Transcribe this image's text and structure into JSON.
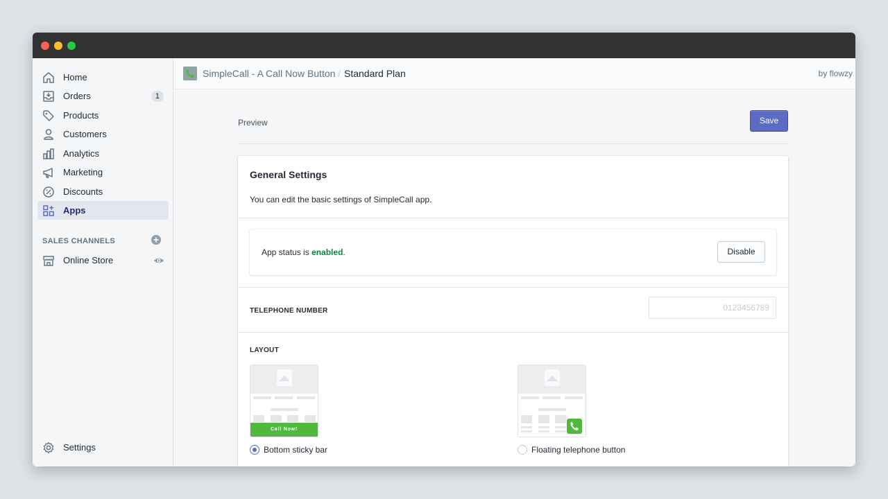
{
  "sidebar": {
    "items": [
      {
        "label": "Home",
        "icon": "home-icon"
      },
      {
        "label": "Orders",
        "icon": "orders-icon",
        "badge": "1"
      },
      {
        "label": "Products",
        "icon": "tag-icon"
      },
      {
        "label": "Customers",
        "icon": "person-icon"
      },
      {
        "label": "Analytics",
        "icon": "bar-chart-icon"
      },
      {
        "label": "Marketing",
        "icon": "megaphone-icon"
      },
      {
        "label": "Discounts",
        "icon": "discount-icon"
      },
      {
        "label": "Apps",
        "icon": "apps-icon",
        "active": true
      }
    ],
    "sales_channels_title": "SALES CHANNELS",
    "online_store_label": "Online Store",
    "settings_label": "Settings"
  },
  "topbar": {
    "app_name": "SimpleCall - A Call Now Button",
    "separator": "/",
    "page": "Standard Plan",
    "by": "by flowzy"
  },
  "main": {
    "preview_label": "Preview",
    "save_label": "Save",
    "card_title": "General Settings",
    "card_description": "You can edit the basic settings of SimpleCall app.",
    "status_prefix": "App status is ",
    "status_value": "enabled",
    "status_suffix": ".",
    "disable_label": "Disable",
    "telephone_label": "TELEPHONE NUMBER",
    "telephone_placeholder": "0123456789",
    "telephone_value": "",
    "layout_label": "LAYOUT",
    "sticky_bar_text": "Call Now!",
    "layout_options": [
      {
        "label": "Bottom sticky bar",
        "selected": true
      },
      {
        "label": "Floating telephone button",
        "selected": false
      }
    ]
  },
  "colors": {
    "accent": "#5c6ac4",
    "enabled": "#108043",
    "call_green": "#50b83c",
    "titlebar": "#333333"
  }
}
